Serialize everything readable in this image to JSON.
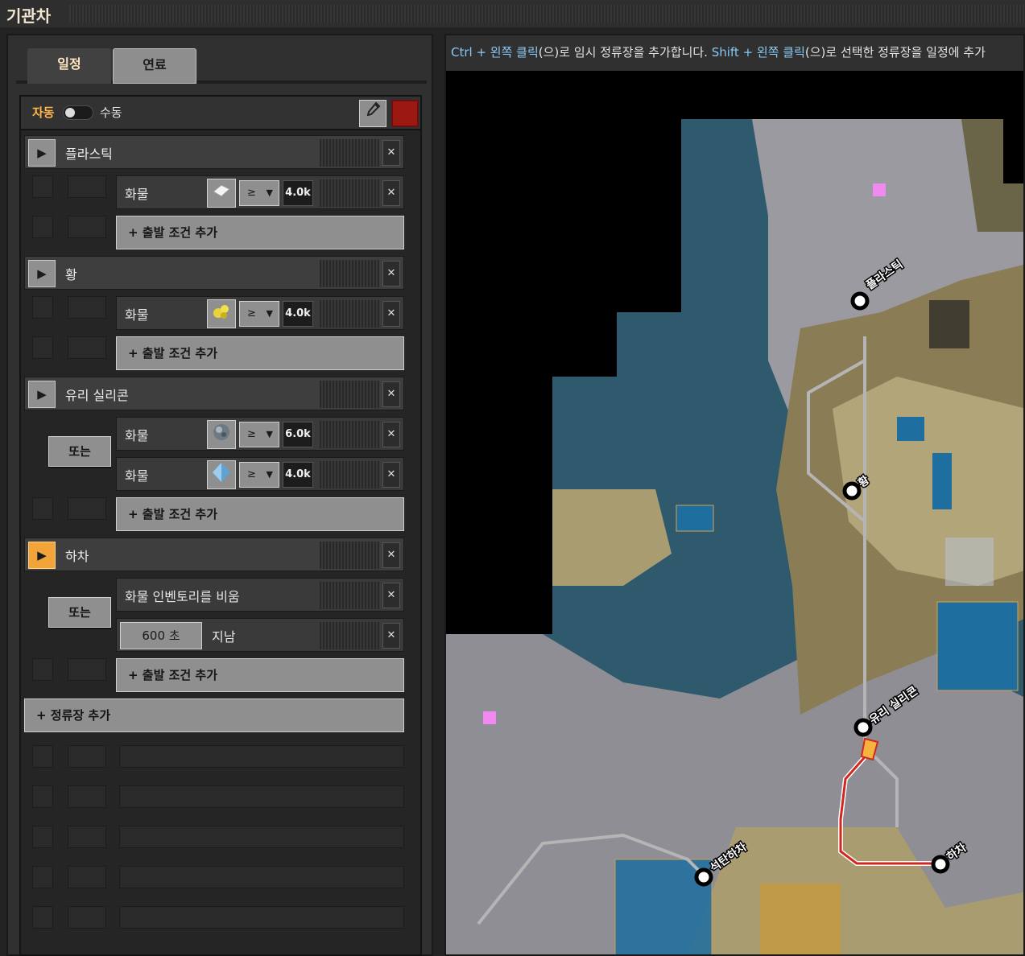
{
  "window": {
    "title": "기관차"
  },
  "tabs": [
    {
      "label": "일정"
    },
    {
      "label": "연료"
    }
  ],
  "schedule": {
    "auto_label": "자동",
    "manual_label": "수동",
    "color": "#9b1813",
    "stations": [
      {
        "name": "플라스틱",
        "conditions": [
          {
            "type": "화물",
            "item_icon": "plastic-bar-icon",
            "comparator": "≥",
            "amount": "4.0k"
          }
        ]
      },
      {
        "name": "황",
        "conditions": [
          {
            "type": "화물",
            "item_icon": "sulfur-icon",
            "comparator": "≥",
            "amount": "4.0k"
          }
        ]
      },
      {
        "name": "유리 실리콘",
        "connector": "또는",
        "conditions": [
          {
            "type": "화물",
            "item_icon": "stone-icon",
            "comparator": "≥",
            "amount": "6.0k"
          },
          {
            "type": "화물",
            "item_icon": "silicon-crystal-icon",
            "comparator": "≥",
            "amount": "4.0k"
          }
        ]
      },
      {
        "name": "하차",
        "active": true,
        "connector": "또는",
        "conditions": [
          {
            "type": "화물 인벤토리를 비움"
          },
          {
            "type": "time",
            "time_value": "600 초",
            "time_label": "지남"
          }
        ]
      }
    ],
    "add_condition_label": "+ 출발 조건 추가",
    "add_station_label": "+ 정류장 추가"
  },
  "map": {
    "hint_ctrl": "Ctrl + 왼쪽 클릭",
    "hint_mid": "(으)로 임시 정류장을 추가합니다. ",
    "hint_shift": "Shift + 왼쪽 클릭",
    "hint_end": "(으)로 선택한 정류장을 일정에 추가",
    "stations": [
      {
        "name": "플라스틱"
      },
      {
        "name": "황"
      },
      {
        "name": "유리 실리콘"
      },
      {
        "name": "석탄하차"
      },
      {
        "name": "하차"
      }
    ]
  }
}
